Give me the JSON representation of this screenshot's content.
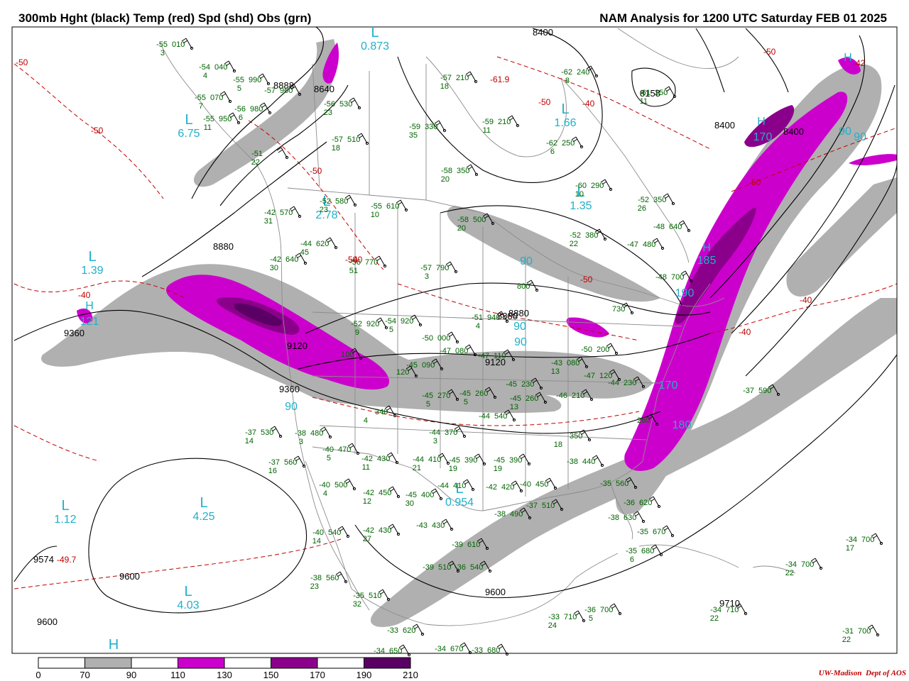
{
  "header": {
    "left_title": "300mb Hght (black) Temp (red) Spd (shd) Obs (grn)",
    "right_title": "NAM Analysis for 1200 UTC Saturday  FEB 01 2025"
  },
  "credit": {
    "org": "UW-Madison",
    "dept": "Dept of AOS"
  },
  "colors": {
    "height_contour": "#000000",
    "temp_contour": "#c00000",
    "obs": "#006400",
    "centers": "#20b0c8",
    "speed_70_90": "#b0b0b0",
    "speed_110_130": "#cc00cc",
    "speed_150_170": "#8b008b",
    "speed_190_210": "#5a0064",
    "border": "#8c8c8c"
  },
  "colorbar": {
    "labels": [
      "0",
      "70",
      "90",
      "110",
      "130",
      "150",
      "170",
      "190",
      "210"
    ],
    "fills": [
      "#ffffff",
      "#b0b0b0",
      "#ffffff",
      "#cc00cc",
      "#ffffff",
      "#8b008b",
      "#ffffff",
      "#5a0064"
    ]
  },
  "height_labels": [
    "8400",
    "8640",
    "8880",
    "8888",
    "8880",
    "8400",
    "8880",
    "9120",
    "9120",
    "9360",
    "9360",
    "9574",
    "9600",
    "9600",
    "9600",
    "9710",
    "8400",
    "8158"
  ],
  "temp_labels": [
    "-50",
    "-50",
    "-50",
    "-50",
    "-40",
    "-50",
    "-50",
    "-40",
    "-40",
    "-40",
    "-40",
    "-50",
    "-50",
    "-49.7",
    "-61.9",
    "-42"
  ],
  "centers": [
    {
      "letter": "L",
      "value": "6.75"
    },
    {
      "letter": "L",
      "value": "2.78"
    },
    {
      "letter": "L",
      "value": "1.39"
    },
    {
      "letter": "L",
      "value": "1.12"
    },
    {
      "letter": "L",
      "value": "4.25"
    },
    {
      "letter": "L",
      "value": "4.03"
    },
    {
      "letter": "L",
      "value": "1.66"
    },
    {
      "letter": "L",
      "value": "1.35"
    },
    {
      "letter": "H",
      "value": ""
    },
    {
      "letter": "L",
      "value": "0.873"
    },
    {
      "letter": "L",
      "value": "0.954"
    }
  ],
  "jet_labels": [
    "H",
    "170",
    "H",
    "185",
    "H",
    "121",
    "H",
    "170",
    "90",
    "90",
    "90",
    "90",
    "90",
    "90",
    "190",
    "180"
  ],
  "obs": [
    {
      "t": "-55",
      "h": "010",
      "d": "3"
    },
    {
      "t": "-54",
      "h": "040",
      "d": "4"
    },
    {
      "t": "-55",
      "h": "990",
      "d": "5"
    },
    {
      "t": "-57",
      "h": "960",
      "d": ""
    },
    {
      "t": "-55",
      "h": "070",
      "d": "7"
    },
    {
      "t": "-56",
      "h": "980",
      "d": "6"
    },
    {
      "t": "-55",
      "h": "950",
      "d": "11"
    },
    {
      "t": "-51",
      "h": "",
      "d": "22"
    },
    {
      "t": "-56",
      "h": "530",
      "d": "23"
    },
    {
      "t": "-57",
      "h": "510",
      "d": "18"
    },
    {
      "t": "-52",
      "h": "580",
      "d": "23"
    },
    {
      "t": "-55",
      "h": "610",
      "d": "10"
    },
    {
      "t": "-42",
      "h": "570",
      "d": "31"
    },
    {
      "t": "-44",
      "h": "620",
      "d": "45"
    },
    {
      "t": "-42",
      "h": "640",
      "d": "30"
    },
    {
      "t": "-56",
      "h": "770",
      "d": "51"
    },
    {
      "t": "-57",
      "h": "790",
      "d": "3"
    },
    {
      "t": "-52",
      "h": "920",
      "d": "9"
    },
    {
      "t": "-54",
      "h": "920",
      "d": "5"
    },
    {
      "t": "-51",
      "h": "940",
      "d": "4"
    },
    {
      "t": "-50",
      "h": "000",
      "d": ""
    },
    {
      "t": "-47",
      "h": "080",
      "d": ""
    },
    {
      "t": "-45",
      "h": "090",
      "d": ""
    },
    {
      "t": "-47",
      "h": "110",
      "d": ""
    },
    {
      "t": "",
      "h": "100",
      "d": ""
    },
    {
      "t": "",
      "h": "120",
      "d": ""
    },
    {
      "t": "",
      "h": "340",
      "d": "4"
    },
    {
      "t": "-37",
      "h": "530",
      "d": "14"
    },
    {
      "t": "-38",
      "h": "480",
      "d": "3"
    },
    {
      "t": "-40",
      "h": "470",
      "d": "5"
    },
    {
      "t": "-37",
      "h": "560",
      "d": "16"
    },
    {
      "t": "-42",
      "h": "430",
      "d": "11"
    },
    {
      "t": "-44",
      "h": "410",
      "d": "21"
    },
    {
      "t": "-45",
      "h": "390",
      "d": "19"
    },
    {
      "t": "-45",
      "h": "390",
      "d": "19"
    },
    {
      "t": "-40",
      "h": "500",
      "d": "4"
    },
    {
      "t": "-42",
      "h": "450",
      "d": "12"
    },
    {
      "t": "-45",
      "h": "400",
      "d": "30"
    },
    {
      "t": "-44",
      "h": "410",
      "d": ""
    },
    {
      "t": "-42",
      "h": "420",
      "d": ""
    },
    {
      "t": "-40",
      "h": "540",
      "d": "14"
    },
    {
      "t": "-42",
      "h": "430",
      "d": "27"
    },
    {
      "t": "-43",
      "h": "430",
      "d": ""
    },
    {
      "t": "-38",
      "h": "560",
      "d": "23"
    },
    {
      "t": "-39",
      "h": "610",
      "d": ""
    },
    {
      "t": "-39",
      "h": "510",
      "d": ""
    },
    {
      "t": "-36",
      "h": "540",
      "d": ""
    },
    {
      "t": "-35",
      "h": "510",
      "d": "32"
    },
    {
      "t": "-33",
      "h": "620",
      "d": ""
    },
    {
      "t": "-34",
      "h": "650",
      "d": ""
    },
    {
      "t": "-34",
      "h": "670",
      "d": ""
    },
    {
      "t": "-33",
      "h": "680",
      "d": ""
    },
    {
      "t": "-33",
      "h": "710",
      "d": "24"
    },
    {
      "t": "-36",
      "h": "700",
      "d": "5"
    },
    {
      "t": "-34",
      "h": "710",
      "d": "22"
    },
    {
      "t": "-31",
      "h": "700",
      "d": "22"
    },
    {
      "t": "-34",
      "h": "700",
      "d": "22"
    },
    {
      "t": "-34",
      "h": "700",
      "d": "17"
    },
    {
      "t": "-37",
      "h": "590",
      "d": ""
    },
    {
      "t": "-35",
      "h": "560",
      "d": ""
    },
    {
      "t": "-36",
      "h": "620",
      "d": ""
    },
    {
      "t": "-38",
      "h": "630",
      "d": ""
    },
    {
      "t": "-35",
      "h": "670",
      "d": ""
    },
    {
      "t": "-35",
      "h": "680",
      "d": "6"
    },
    {
      "t": "-38",
      "h": "440",
      "d": ""
    },
    {
      "t": "-40",
      "h": "450",
      "d": ""
    },
    {
      "t": "-38",
      "h": "490",
      "d": ""
    },
    {
      "t": "-37",
      "h": "510",
      "d": ""
    },
    {
      "t": "-45",
      "h": "230",
      "d": ""
    },
    {
      "t": "-45",
      "h": "260",
      "d": "13"
    },
    {
      "t": "-46",
      "h": "210",
      "d": ""
    },
    {
      "t": "-45",
      "h": "270",
      "d": "5"
    },
    {
      "t": "-45",
      "h": "260",
      "d": "5"
    },
    {
      "t": "-44",
      "h": "370",
      "d": "3"
    },
    {
      "t": "-44",
      "h": "540",
      "d": ""
    },
    {
      "t": "",
      "h": "350",
      "d": "18"
    },
    {
      "t": "-43",
      "h": "080",
      "d": "13"
    },
    {
      "t": "-50",
      "h": "200",
      "d": ""
    },
    {
      "t": "-47",
      "h": "120",
      "d": ""
    },
    {
      "t": "-44",
      "h": "230",
      "d": ""
    },
    {
      "t": "",
      "h": "260",
      "d": ""
    },
    {
      "t": "-57",
      "h": "210",
      "d": "18"
    },
    {
      "t": "-59",
      "h": "330",
      "d": "35"
    },
    {
      "t": "-58",
      "h": "350",
      "d": "20"
    },
    {
      "t": "-59",
      "h": "210",
      "d": "11"
    },
    {
      "t": "-62",
      "h": "250",
      "d": "6"
    },
    {
      "t": "-60",
      "h": "290",
      "d": "10"
    },
    {
      "t": "-52",
      "h": "350",
      "d": "26"
    },
    {
      "t": "-52",
      "h": "380",
      "d": "22"
    },
    {
      "t": "-47",
      "h": "480",
      "d": ""
    },
    {
      "t": "-48",
      "h": "640",
      "d": ""
    },
    {
      "t": "-48",
      "h": "700",
      "d": ""
    },
    {
      "t": "-58",
      "h": "500",
      "d": "20"
    },
    {
      "t": "",
      "h": "800",
      "d": ""
    },
    {
      "t": "",
      "h": "730",
      "d": ""
    },
    {
      "t": "-62",
      "h": "240",
      "d": "8"
    },
    {
      "t": "-61",
      "h": "250",
      "d": "11"
    }
  ]
}
